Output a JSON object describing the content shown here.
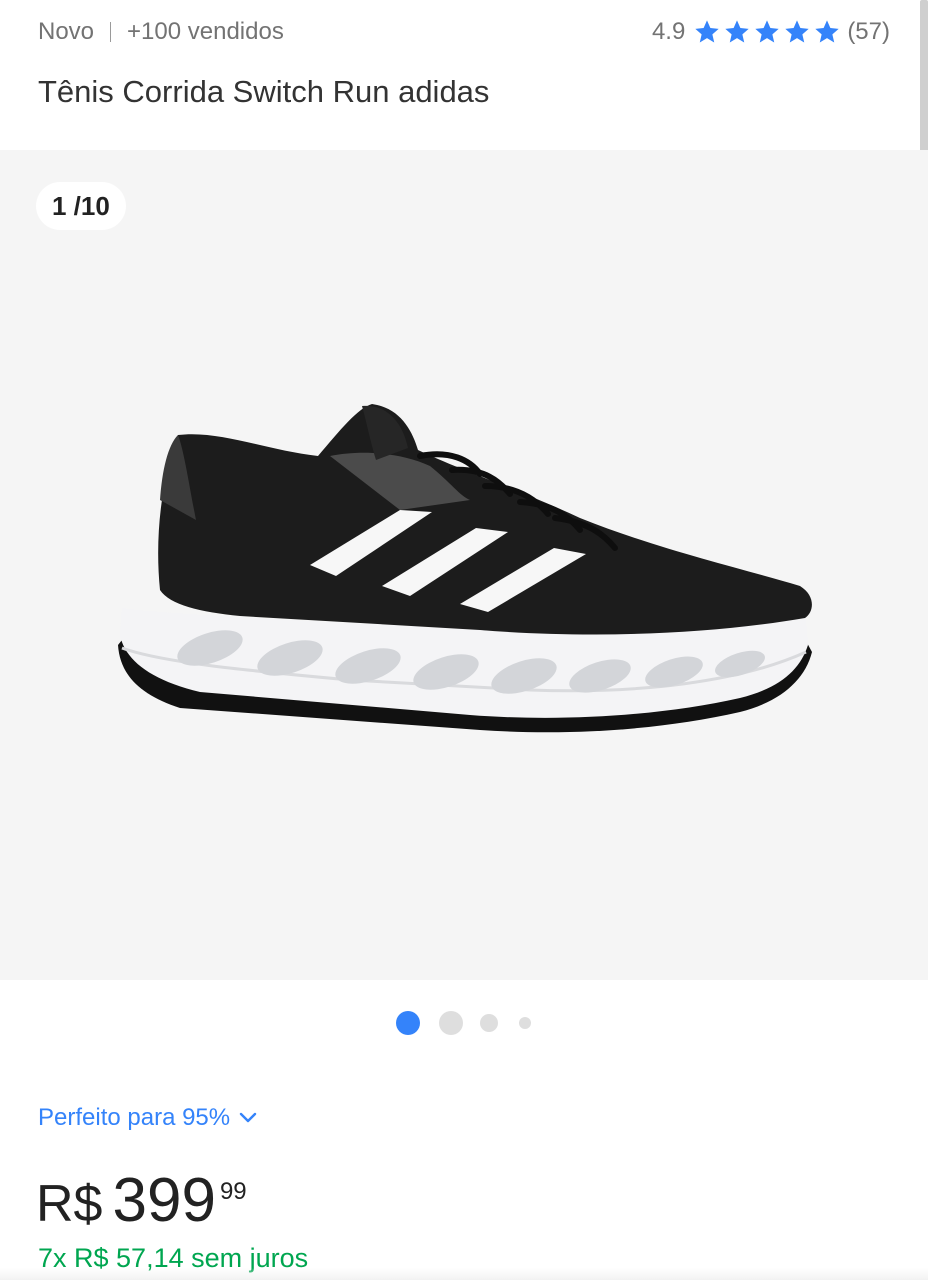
{
  "header": {
    "condition": "Novo",
    "sold": "+100 vendidos",
    "rating_value": "4.9",
    "rating_stars": 5,
    "rating_count": "(57)",
    "star_color": "#3483fa",
    "title": "Tênis Corrida Switch Run adidas"
  },
  "gallery": {
    "counter": "1 /10",
    "image_icon": "running-shoe-image",
    "pagination": {
      "dots": 4,
      "active_index": 0,
      "active_color": "#3483fa",
      "inactive_color": "#dedede"
    }
  },
  "fit": {
    "label": "Perfeito para 95%",
    "icon": "chevron-down-icon"
  },
  "price": {
    "currency": "R$",
    "integer": "399",
    "cents": "99",
    "installments": "7x R$ 57,14 sem juros",
    "installments_color": "#00a650"
  }
}
